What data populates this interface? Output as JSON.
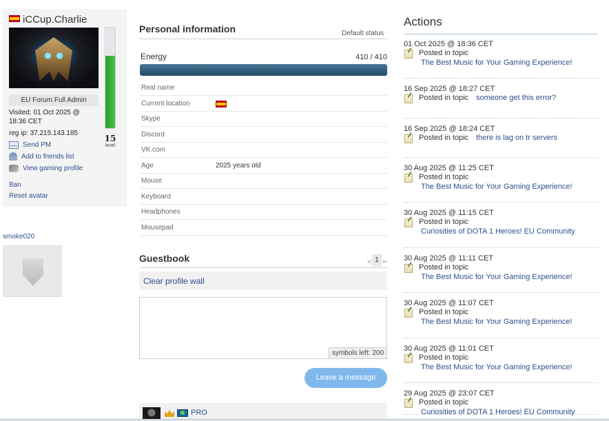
{
  "profile": {
    "username": "iCCup.Charlie",
    "level": "15",
    "level_word": "level",
    "level_fraction": 0.72,
    "rank": "EU Forum Full Admin",
    "visited": "Visited: 01 Oct 2025 @ 18:36 CET",
    "reg_ip": "reg ip: 37.215.143.185",
    "actions": [
      "Send PM",
      "Add to friends list",
      "View gaming profile"
    ],
    "links": [
      "Ban",
      "Reset avatar"
    ]
  },
  "friend": {
    "name": "smoke020"
  },
  "personal": {
    "title": "Personal information",
    "default_status": "Default status",
    "energy_label": "Energy",
    "energy_value": "410 / 410",
    "energy_fraction": 1.0,
    "rows": [
      {
        "label": "Real name",
        "value": ""
      },
      {
        "label": "Current location",
        "value": ""
      },
      {
        "label": "Skype",
        "value": ""
      },
      {
        "label": "Discord",
        "value": ""
      },
      {
        "label": "VK.com",
        "value": ""
      },
      {
        "label": "Age",
        "value": "2025 years old"
      },
      {
        "label": "Mouse",
        "value": ""
      },
      {
        "label": "Keyboard",
        "value": ""
      },
      {
        "label": "Headphones",
        "value": ""
      },
      {
        "label": "Mousepad",
        "value": ""
      }
    ]
  },
  "guestbook": {
    "title": "Guestbook",
    "pager_prev": "«",
    "pager_current": "1",
    "pager_next": "»",
    "clear_wall": "Clear profile wall",
    "symbols_left": "symbols left: 200",
    "leave_button": "Leave a message",
    "entry_name": "PRO"
  },
  "actions": {
    "title": "Actions",
    "posted_label": "Posted in topic",
    "items": [
      {
        "time": "01 Oct 2025 @ 18:36 CET",
        "topic": "The Best Music for Your Gaming Experience!",
        "wrap": true
      },
      {
        "time": "16 Sep 2025 @ 18:27 CET",
        "topic": "someone get this error?",
        "wrap": false
      },
      {
        "time": "16 Sep 2025 @ 18:24 CET",
        "topic": "there is lag on tr servers",
        "wrap": false
      },
      {
        "time": "30 Aug 2025 @ 11:25 CET",
        "topic": "The Best Music for Your Gaming Experience!",
        "wrap": true
      },
      {
        "time": "30 Aug 2025 @ 11:15 CET",
        "topic": "Curiosities of DOTA 1 Heroes! EU Community",
        "wrap": true
      },
      {
        "time": "30 Aug 2025 @ 11:11 CET",
        "topic": "The Best Music for Your Gaming Experience!",
        "wrap": true
      },
      {
        "time": "30 Aug 2025 @ 11:07 CET",
        "topic": "The Best Music for Your Gaming Experience!",
        "wrap": true
      },
      {
        "time": "30 Aug 2025 @ 11:01 CET",
        "topic": "The Best Music for Your Gaming Experience!",
        "wrap": true
      },
      {
        "time": "29 Aug 2025 @ 23:07 CET",
        "topic": "Curiosities of DOTA 1 Heroes! EU Community",
        "wrap": true
      }
    ]
  },
  "icons": {
    "flag": "spain-flag-icon",
    "send_pm": "envelope-icon",
    "friend": "user-add-icon",
    "gaming": "gamepad-icon",
    "post": "note-edit-icon"
  },
  "colors": {
    "link": "#2e4e8c",
    "energy": "#2d5b7a",
    "level": "#3db33e",
    "button": "#7fb9ec"
  }
}
